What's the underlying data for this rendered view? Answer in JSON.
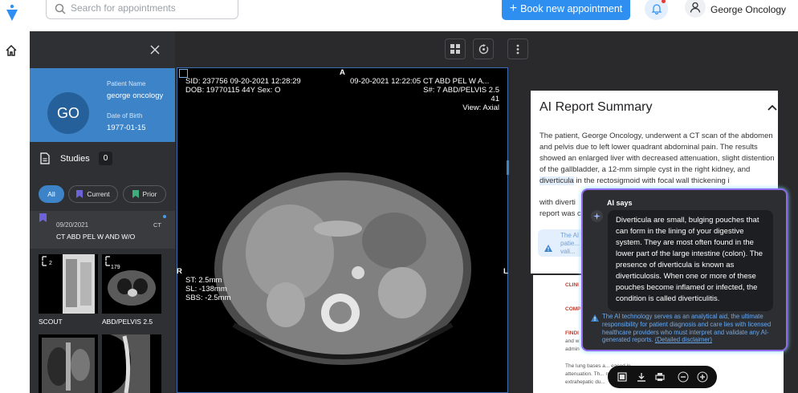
{
  "header": {
    "search_placeholder": "Search for appointments",
    "book_button": "Book new appointment",
    "user_name": "George Oncology"
  },
  "patient": {
    "initials": "GO",
    "name_label": "Patient Name",
    "name": "george oncology",
    "dob_label": "Date of Birth",
    "dob": "1977-01-15"
  },
  "studies": {
    "label": "Studies",
    "count": "0",
    "filters": {
      "all": "All",
      "current": "Current",
      "prior": "Prior"
    },
    "item": {
      "date": "09/20/2021",
      "modality": "CT",
      "description": "CT ABD PEL W AND W/O"
    },
    "thumbnails": [
      {
        "label": "SCOUT",
        "count": "2"
      },
      {
        "label": "ABD/PELVIS 2.5",
        "count": "179"
      }
    ]
  },
  "viewport": {
    "top_left": [
      "SID: 237756  09-20-2021 12:28:29",
      "DOB: 19770115  44Y  Sex: O"
    ],
    "top_right": [
      "09-20-2021 12:22:05  CT ABD PEL W A...",
      "S#: 7  ABD/PELVIS 2.5",
      "41",
      "View: Axial"
    ],
    "orient_top": "A",
    "orient_left": "R",
    "orient_right": "L",
    "bottom_left": [
      "ST: 2.5mm",
      "SL: -138mm",
      "SBS: -2.5mm"
    ]
  },
  "report": {
    "title": "AI Report Summary",
    "body_before": "The patient, George Oncology, underwent a CT scan of the abdomen and pelvis due to left lower quadrant abdominal pain. The results showed an enlarged liver with decreased attenuation, slight distention of the gallbladder, a 12-mm simple cyst in the right kidney, and ",
    "body_highlight": "diverticula",
    "body_after": " in the rectosigmoid with focal wall thickening i",
    "line_with": "with diverti",
    "line_report": "report was c",
    "note_text": "The AI t... for patie... and vali...",
    "pdf": {
      "clin": "CLINI",
      "comp": "COMP",
      "find": "FINDI",
      "find_lines": [
        "and w",
        "admin"
      ],
      "bottom_lines": [
        "The lung bases a...                                  eased in",
        "attenuation. Th...                                  ntra or",
        "extrahepatic du..."
      ]
    }
  },
  "ai_popup": {
    "title": "AI says",
    "text": "Diverticula are small, bulging pouches that can form in the lining of your digestive system. They are most often found in the lower part of the large intestine (colon). The presence of diverticula is known as diverticulosis. When one or more of these pouches become inflamed or infected, the condition is called diverticulitis.",
    "disclaimer": "The AI technology serves as an analytical aid, the ultimate responsibility for patient diagnosis and care lies with licensed healthcare providers who must interpret and validate any AI-generated reports.",
    "disclaimer_link": "(Detailed disclaimer)"
  },
  "colors": {
    "brand_blue": "#2f8ff0",
    "patient_card": "#3d83c7",
    "ai_border": "#8e6be8"
  },
  "icons": [
    "logo-icon",
    "search-icon",
    "bell-icon",
    "user-icon",
    "home-icon",
    "close-icon",
    "document-icon",
    "bookmark-icon",
    "grid-icon",
    "reset-icon",
    "more-icon",
    "chevron-up-icon",
    "info-icon",
    "sparkle-icon"
  ]
}
